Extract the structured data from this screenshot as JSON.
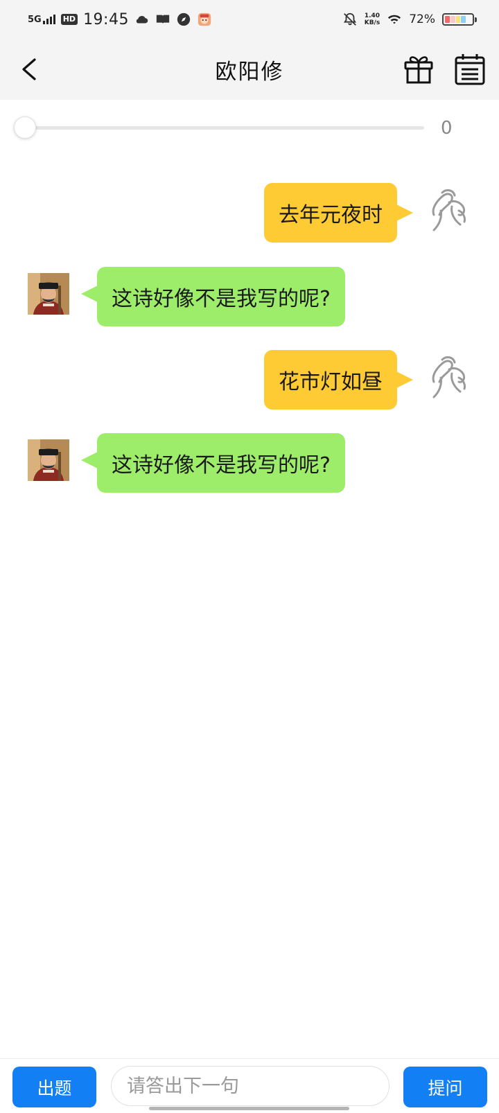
{
  "status_bar": {
    "network": "5G",
    "hd_badge": "HD",
    "time": "19:45",
    "speed_value": "1.40",
    "speed_unit": "KB/s",
    "battery_percent": "72%",
    "icons": [
      "cloud-icon",
      "book-icon",
      "compass-icon",
      "app-avatar-icon",
      "bell-off-icon",
      "wifi-icon",
      "battery-icon"
    ]
  },
  "header": {
    "title": "欧阳修",
    "back_icon": "chevron-left-icon",
    "gift_icon": "gift-icon",
    "calendar_icon": "calendar-list-icon"
  },
  "progress": {
    "value": "0",
    "fraction": 0
  },
  "messages": [
    {
      "sender": "user",
      "text": "去年元夜时"
    },
    {
      "sender": "bot",
      "text": "这诗好像不是我写的呢?"
    },
    {
      "sender": "user",
      "text": "花市灯如昼"
    },
    {
      "sender": "bot",
      "text": "这诗好像不是我写的呢?"
    }
  ],
  "bottom_bar": {
    "question_button": "出题",
    "input_placeholder": "请答出下一句",
    "input_value": "",
    "ask_button": "提问"
  },
  "colors": {
    "user_bubble": "#fecb34",
    "bot_bubble": "#9ded6a",
    "button_blue": "#137ff4",
    "header_bg": "#f4f4f4"
  }
}
